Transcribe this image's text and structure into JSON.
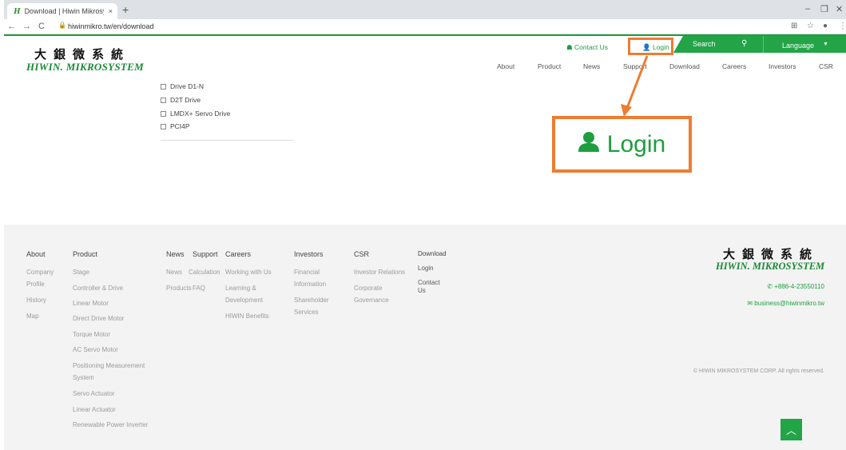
{
  "browser": {
    "tab_title": "Download | Hiwin Mikrosystem",
    "tab_favicon": "H",
    "url": "hiwinmikro.tw/en/download",
    "new_tab": "+",
    "tab_close": "×"
  },
  "header": {
    "logo_cn": "大銀微系統",
    "logo_en": "HIWIN. MIKROSYSTEM",
    "contact_us": "Contact Us",
    "login": "Login",
    "search": "Search",
    "language": "Language",
    "nav": [
      "About",
      "Product",
      "News",
      "Support",
      "Download",
      "Careers",
      "Investors",
      "CSR"
    ]
  },
  "content": {
    "checkbox_items": [
      "Drive D1-N",
      "D2T Drive",
      "LMDX+ Servo Drive",
      "PCI4P"
    ]
  },
  "callout": {
    "zoom_label": "Login",
    "color": "#ed7d31"
  },
  "footer": {
    "about": {
      "head": "About",
      "items": [
        "Company",
        "Profile",
        "History",
        "Map"
      ]
    },
    "product": {
      "head": "Product",
      "items": [
        "Stage",
        "Controller & Drive",
        "Linear Motor",
        "Direct Drive Motor",
        "Torque Motor",
        "AC Servo Motor",
        "Positioning Measurement",
        "System",
        "Servo Actuator",
        "Linear Actuator",
        "Renewable Power Inverter"
      ]
    },
    "news": {
      "head": "News",
      "items": [
        "News",
        "Products"
      ]
    },
    "support": {
      "head": "Support",
      "items": [
        "Calculation",
        "FAQ"
      ]
    },
    "careers": {
      "head": "Careers",
      "items": [
        "Working with Us",
        "Learning &",
        "Development",
        "HIWIN Benefits"
      ]
    },
    "investors": {
      "head": "Investors",
      "items": [
        "Financial",
        "Information",
        "Shareholder",
        "Services"
      ]
    },
    "csr": {
      "head": "CSR",
      "items": [
        "Investor Relations",
        "Corporate",
        "Governance"
      ]
    },
    "download": {
      "head": "Download",
      "items": [
        "Login",
        "Contact",
        "Us"
      ]
    },
    "logo_cn": "大銀微系統",
    "logo_en": "HIWIN. MIKROSYSTEM",
    "phone": "+886-4-23550110",
    "email": "business@hiwinmikro.tw",
    "copyright": "© HIWIN MIKROSYSTEM CORP. All rights reserved.",
    "to_top": "︿"
  },
  "colors": {
    "brand_green": "#22a447",
    "accent_orange": "#ed7d31"
  }
}
